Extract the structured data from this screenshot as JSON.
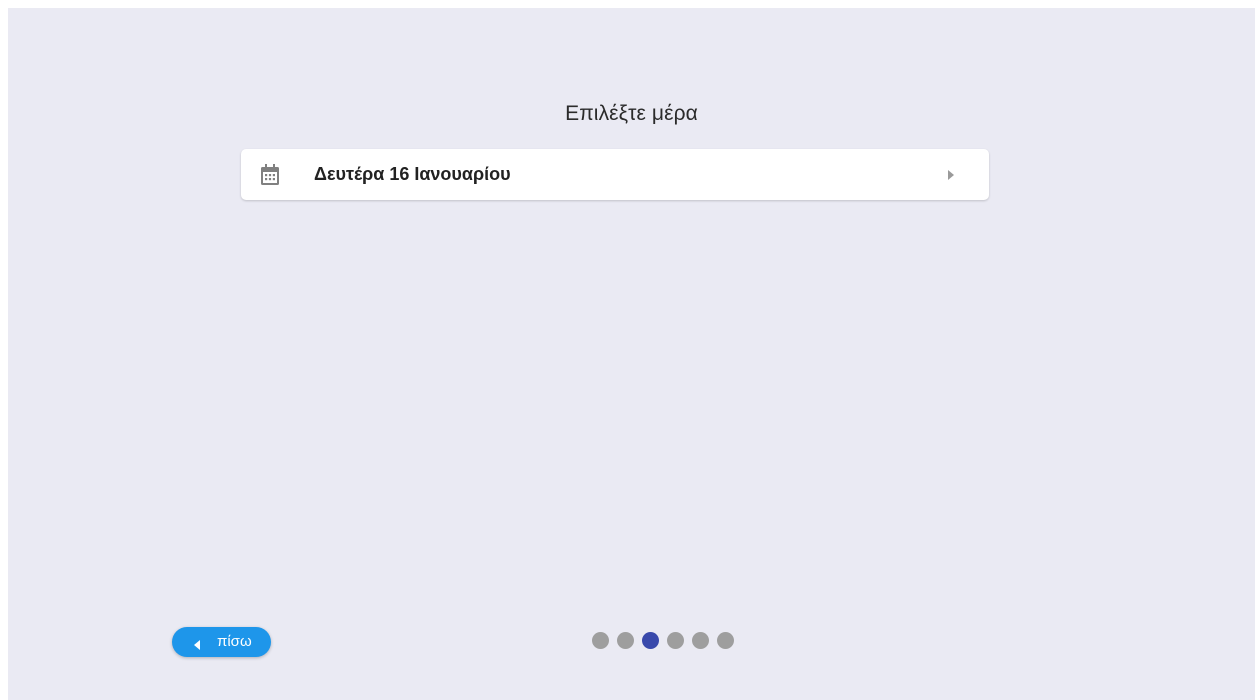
{
  "page": {
    "title": "Επιλέξτε μέρα"
  },
  "days": [
    {
      "label": "Δευτέρα 16 Ιανουαρίου",
      "icon": "calendar-icon",
      "trailing_icon": "chevron-right-icon"
    }
  ],
  "back_button": {
    "label": "πίσω",
    "icon": "chevron-left-icon",
    "color": "#1e96ea"
  },
  "pagination": {
    "total_steps": 6,
    "current_step": 3,
    "active_color": "#3949ab",
    "inactive_color": "#9e9e9e"
  }
}
